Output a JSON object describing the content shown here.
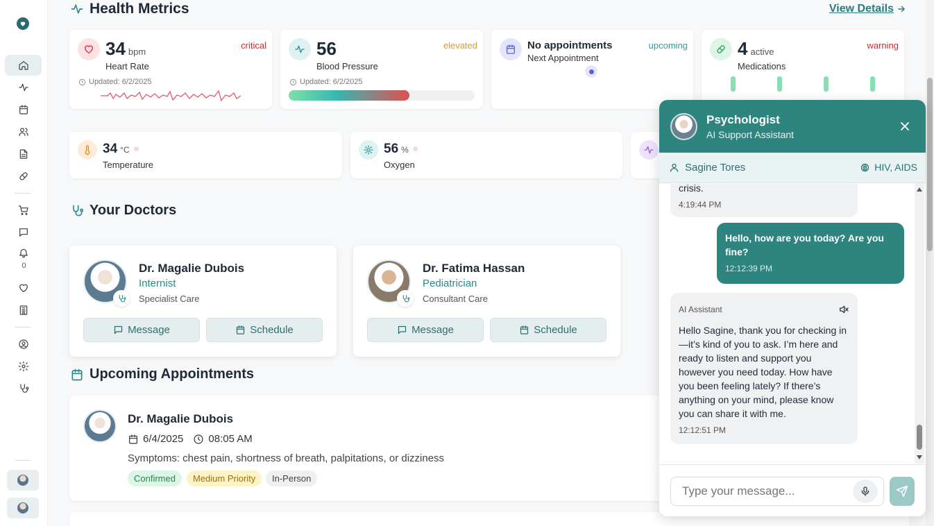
{
  "sidebar": {
    "bell_count": "0"
  },
  "header": {
    "title": "Health Metrics",
    "view_details": "View Details"
  },
  "metrics": [
    {
      "value": "34",
      "unit": "bpm",
      "label": "Heart Rate",
      "status": "critical",
      "status_color": "#e02424",
      "updated": "Updated: 6/2/2025",
      "icon": "heart-icon"
    },
    {
      "value": "56",
      "unit": "",
      "label": "Blood Pressure",
      "status": "elevated",
      "status_color": "#d69e2e",
      "updated": "Updated: 6/2/2025",
      "icon": "activity-icon",
      "progress": 0.65
    },
    {
      "value": "No appointments",
      "label": "Next Appointment",
      "status": "upcoming",
      "status_color": "#2a9d9a",
      "icon": "calendar-icon"
    },
    {
      "value": "4",
      "unit": "active",
      "label": "Medications",
      "status": "warning",
      "status_color": "#e02424",
      "icon": "pill-icon"
    }
  ],
  "small_metrics": [
    {
      "value": "34",
      "unit": "°C",
      "label": "Temperature",
      "icon": "thermometer-icon"
    },
    {
      "value": "56",
      "unit": "%",
      "label": "Oxygen",
      "icon": "oxygen-icon"
    }
  ],
  "doctors_section": {
    "title": "Your Doctors"
  },
  "doctors": [
    {
      "name": "Dr. Magalie Dubois",
      "specialty": "Internist",
      "care": "Specialist Care",
      "message": "Message",
      "schedule": "Schedule"
    },
    {
      "name": "Dr. Fatima Hassan",
      "specialty": "Pediatrician",
      "care": "Consultant Care",
      "message": "Message",
      "schedule": "Schedule"
    }
  ],
  "appointments_section": {
    "title": "Upcoming Appointments"
  },
  "appointment": {
    "doctor": "Dr. Magalie Dubois",
    "date": "6/4/2025",
    "time": "08:05 AM",
    "symptoms": "Symptoms: chest pain, shortness of breath, palpitations, or dizziness",
    "tags": [
      "Confirmed",
      "Medium Priority",
      "In-Person"
    ]
  },
  "chat": {
    "title": "Psychologist",
    "subtitle": "AI Support Assistant",
    "patient": "Sagine Tores",
    "conditions": "HIV, AIDS",
    "messages": [
      {
        "from": "assistant",
        "text": "crisis.",
        "time": "4:19:44 PM"
      },
      {
        "from": "user",
        "text": "Hello, how are you today? Are you fine?",
        "time": "12:12:39 PM"
      },
      {
        "from": "assistant",
        "sender": "AI Assistant",
        "text": "Hello Sagine, thank you for checking in—it’s kind of you to ask. I’m here and ready to listen and support you however you need today. How have you been feeling lately? If there’s anything on your mind, please know you can share it with me.",
        "time": "12:12:51 PM"
      }
    ],
    "input_placeholder": "Type your message..."
  }
}
